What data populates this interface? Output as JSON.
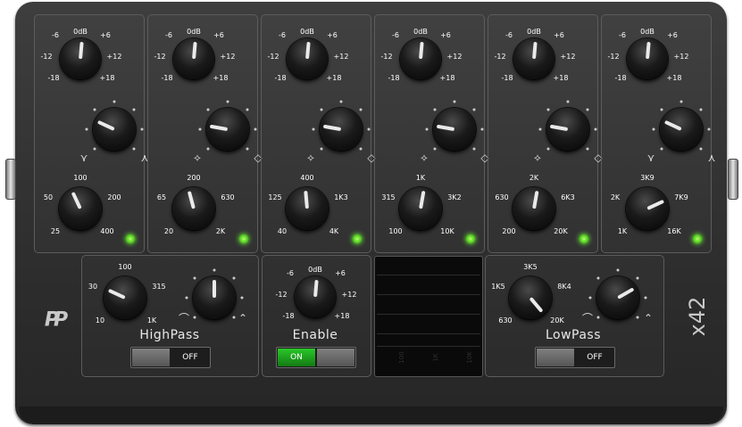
{
  "brand": {
    "logo": "PP",
    "model": "x42"
  },
  "gain_labels": [
    "-6",
    "0dB",
    "+6",
    "-12",
    "+12",
    "-18",
    "+18"
  ],
  "bands": [
    {
      "freq_labels": [
        "100",
        "50",
        "200",
        "25",
        "400"
      ]
    },
    {
      "freq_labels": [
        "200",
        "65",
        "630",
        "20",
        "2K"
      ]
    },
    {
      "freq_labels": [
        "400",
        "125",
        "1K3",
        "40",
        "4K"
      ]
    },
    {
      "freq_labels": [
        "1K",
        "315",
        "3K2",
        "100",
        "10K"
      ]
    },
    {
      "freq_labels": [
        "2K",
        "630",
        "6K3",
        "200",
        "20K"
      ]
    },
    {
      "freq_labels": [
        "3K9",
        "2K",
        "7K9",
        "1K",
        "16K"
      ]
    }
  ],
  "highpass": {
    "title": "HighPass",
    "freq_labels": [
      "100",
      "30",
      "315",
      "10",
      "1K"
    ],
    "switch_label": "OFF"
  },
  "enable": {
    "title": "Enable",
    "gain_labels": [
      "-6",
      "0dB",
      "+6",
      "-12",
      "+12",
      "-18",
      "+18"
    ],
    "switch_label": "ON"
  },
  "lowpass": {
    "title": "LowPass",
    "freq_labels": [
      "3K5",
      "1K5",
      "8K4",
      "630",
      "20K"
    ],
    "switch_label": "OFF"
  },
  "scope": {
    "labels": [
      "100",
      "1K",
      "10K"
    ]
  },
  "colors": {
    "led": "#5fd62a",
    "on": "#1ea51e",
    "chassis": "#333333"
  }
}
